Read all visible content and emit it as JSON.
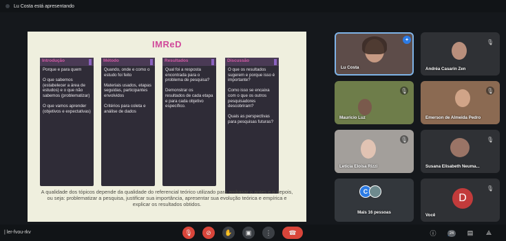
{
  "topbar": {
    "presenting": "Lu Costa está apresentando"
  },
  "slide": {
    "title": "IMReD",
    "columns": [
      {
        "header": "Introdução",
        "body": "Porque e para quem\n\nO que sabemos (estabelecer a área de estudos) e o que não sabemos (problematizar)\n\nO que vamos aprender (objetivos e expectativas)"
      },
      {
        "header": "Método",
        "body": "Quando, onde e como o estudo foi feito\n\nMateriais usados, etapas seguidas, participantes envolvidos\n\nCritérios para coleta e análise de dados"
      },
      {
        "header": "Resultados",
        "body": "Qual foi a resposta encontrada para o problema de pesquisa?\n\nDemonstrar os resultados de cada etapa e para cada objetivo específico."
      },
      {
        "header": "Discussão",
        "body": "O que os resultados sugerem e porque isso é importante?\n\nComo isso se encaixa com o que os outros pesquisadores descobriram?\n\nQuais as perspectivas para pesquisas futuras?"
      }
    ],
    "footnote": "A qualidade dos tópicos depende da qualidade do referencial teórico utilizado para embasar o antes e o depois, ou seja: problematizar a pesquisa, justificar sua importância, apresentar sua evolução teórica e empírica e explicar os resultados obtidos."
  },
  "participants": {
    "lu": "Lu Costa",
    "andrea": "Andréa Casarin Zen",
    "mauricio": "Mauricio Luz",
    "emerson": "Emerson de Almeida Pedro",
    "leticia": "Letícia Eloísa Rizzi",
    "susana": "Susana Elisabeth Neuma...",
    "more": "Mais 16 pessoas",
    "more_initial": "C",
    "voce": "Você",
    "voce_initial": "D"
  },
  "bottom": {
    "meeting_code": "ler-fvou-rkv",
    "participant_count": "24"
  },
  "colors": {
    "accent": "#d1489a",
    "column_bg": "#2f2c37",
    "hangup": "#d9453a",
    "active_border": "#7fb4e8"
  }
}
